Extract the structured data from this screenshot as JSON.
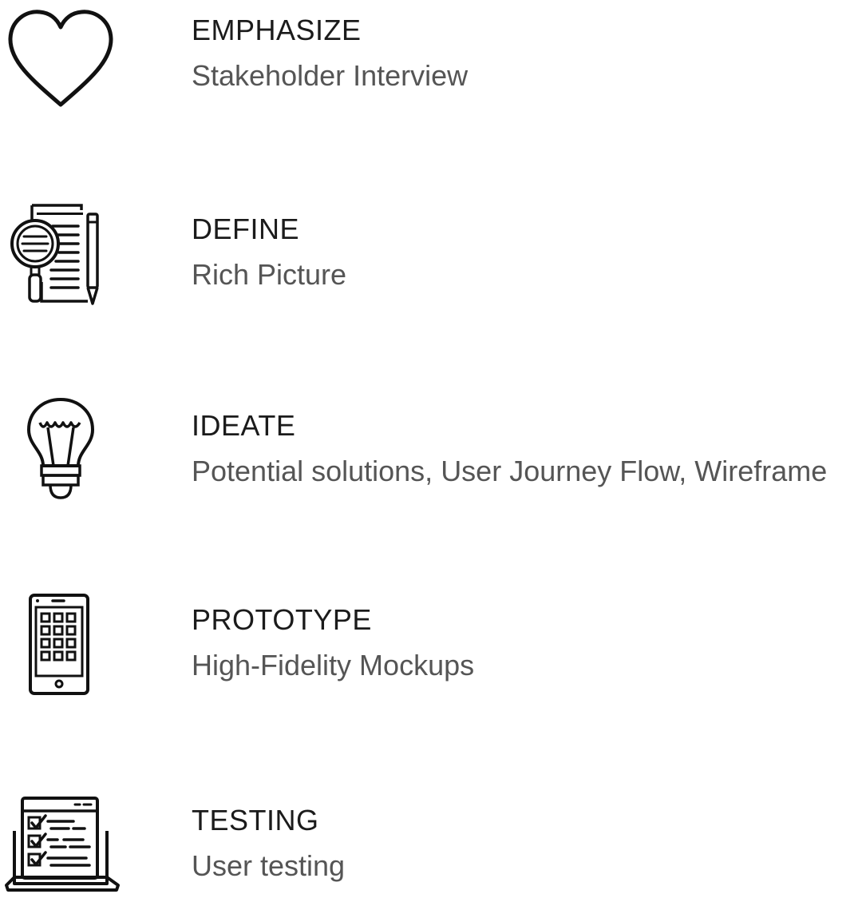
{
  "steps": [
    {
      "title": "EMPHASIZE",
      "description": "Stakeholder Interview",
      "icon": "heart-icon"
    },
    {
      "title": "DEFINE",
      "description": "Rich Picture",
      "icon": "document-magnifier-pencil-icon"
    },
    {
      "title": "IDEATE",
      "description": "Potential solutions, User Journey Flow, Wireframe",
      "icon": "lightbulb-icon"
    },
    {
      "title": "PROTOTYPE",
      "description": "High-Fidelity Mockups",
      "icon": "tablet-app-grid-icon"
    },
    {
      "title": "TESTING",
      "description": "User testing",
      "icon": "laptop-checklist-icon"
    }
  ],
  "colors": {
    "title": "#1b1b1b",
    "description": "#555555",
    "icon_stroke": "#111111"
  }
}
